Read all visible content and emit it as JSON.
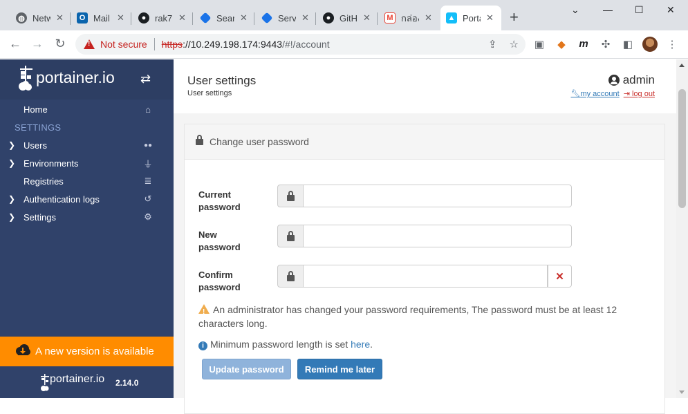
{
  "browser": {
    "tabs": [
      {
        "label": "Netw",
        "icon": "globe-icon",
        "color": "#5f6368"
      },
      {
        "label": "Mail",
        "icon": "outlook-icon",
        "color": "#0a64ad"
      },
      {
        "label": "rak7",
        "icon": "github-icon",
        "color": "#1b1f23"
      },
      {
        "label": "Sear",
        "icon": "azure-icon",
        "color": "#1a73e8"
      },
      {
        "label": "Servi",
        "icon": "azure-icon",
        "color": "#1a73e8"
      },
      {
        "label": "GitH",
        "icon": "github-icon",
        "color": "#1b1f23"
      },
      {
        "label": "กล่อง",
        "icon": "gmail-icon",
        "color": "#ea4335"
      },
      {
        "label": "Porta",
        "icon": "portainer-icon",
        "color": "#13bef9"
      }
    ],
    "close_glyph": "✕",
    "new_tab_glyph": "+",
    "security": "Not secure",
    "url_scheme": "https",
    "url_host": "://10.249.198.174:9443",
    "url_path": "/#!/account"
  },
  "sidebar": {
    "brand": "portainer.io",
    "section": "SETTINGS",
    "home": "Home",
    "items": [
      {
        "label": "Users",
        "icon": "users-icon",
        "glyph": "👥"
      },
      {
        "label": "Environments",
        "icon": "plug-icon",
        "glyph": "🔌"
      },
      {
        "label": "Registries",
        "icon": "database-icon",
        "glyph": "≣"
      },
      {
        "label": "Authentication logs",
        "icon": "history-icon",
        "glyph": "↺"
      },
      {
        "label": "Settings",
        "icon": "cogs-icon",
        "glyph": "⚙"
      }
    ],
    "update_banner": "A new version is available",
    "footer_brand": "portainer.io",
    "version": "2.14.0"
  },
  "header": {
    "title": "User settings",
    "breadcrumb": "User settings",
    "username": "admin",
    "my_account": "my account",
    "log_out": "log out"
  },
  "form": {
    "title": "Change user password",
    "current_label": "Current password",
    "new_label": "New password",
    "confirm_label": "Confirm password",
    "current_value": "",
    "new_value": "",
    "confirm_value": "",
    "warning": "An administrator has changed your password requirements, The password must be at least 12 characters long.",
    "info_prefix": "Minimum password length is set ",
    "info_link": "here",
    "info_suffix": ".",
    "update_button": "Update password",
    "remind_button": "Remind me later"
  },
  "colors": {
    "sidebar_bg": "#30426a",
    "banner": "#ff8c00",
    "primary": "#337ab7",
    "danger": "#c9302c",
    "warning": "#f0ad4e"
  }
}
